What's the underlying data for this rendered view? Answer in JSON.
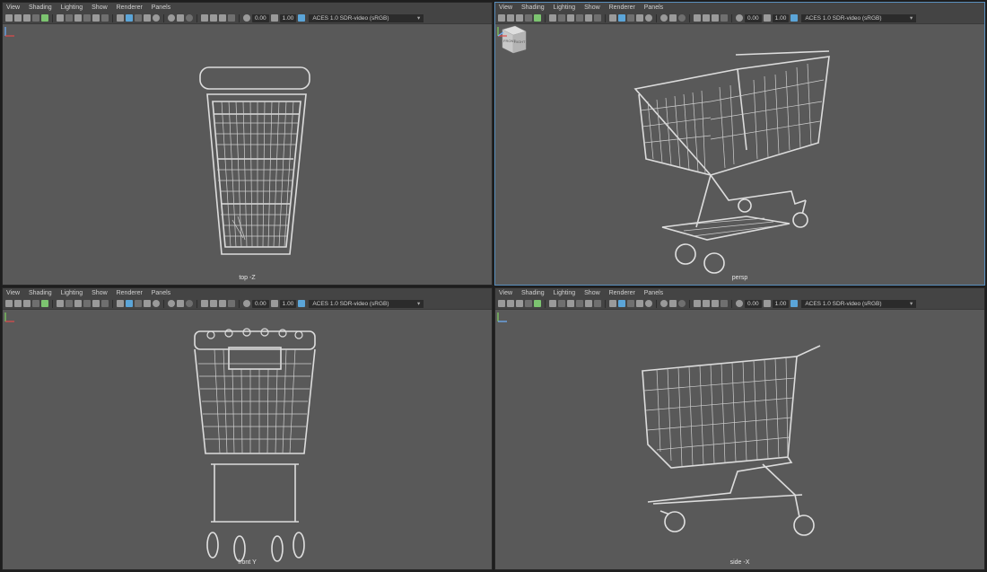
{
  "menu": [
    "View",
    "Shading",
    "Lighting",
    "Show",
    "Renderer",
    "Panels"
  ],
  "toolbar": {
    "exposure": "0.00",
    "gamma": "1.00",
    "color_space": "ACES 1.0 SDR-video (sRGB)"
  },
  "viewports": [
    {
      "camera": "top -Z"
    },
    {
      "camera": "persp"
    },
    {
      "camera": "front Y"
    },
    {
      "camera": "side -X"
    }
  ],
  "viewcube": {
    "front": "FRONT",
    "right": "RIGHT"
  },
  "colors": {
    "viewport_bg": "#595959",
    "panel_bar": "#444444",
    "active_border": "#5a8fbd",
    "wire": "#d9d9d9"
  },
  "icons": [
    "camera-icon",
    "bookmark-icon",
    "grid-icon",
    "wireframe-icon",
    "shaded-icon",
    "lights-icon",
    "shadows-icon",
    "isolate-icon",
    "xray-icon",
    "resolution-gate-icon"
  ]
}
